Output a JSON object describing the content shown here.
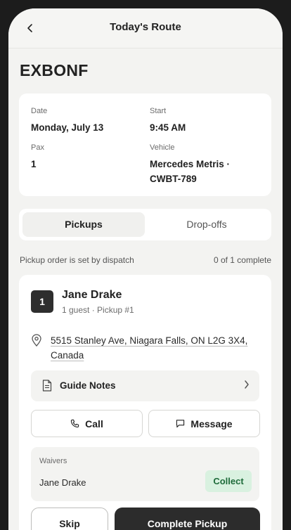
{
  "header": {
    "title": "Today's Route",
    "back_icon": "chevron-left-icon"
  },
  "route_code": "EXBONF",
  "details": {
    "date_label": "Date",
    "date_value": "Monday, July 13",
    "start_label": "Start",
    "start_value": "9:45 AM",
    "pax_label": "Pax",
    "pax_value": "1",
    "vehicle_label": "Vehicle",
    "vehicle_value": "Mercedes Metris · CWBT-789"
  },
  "tabs": {
    "pickups": "Pickups",
    "dropoffs": "Drop-offs",
    "active": "Pickups"
  },
  "progress": {
    "note": "Pickup order is set by dispatch",
    "status": "0 of 1 complete"
  },
  "stop": {
    "number": "1",
    "name": "Jane Drake",
    "subtitle": "1 guest · Pickup #1",
    "address": "5515 Stanley Ave, Niagara Falls, ON L2G 3X4, Canada",
    "guide_notes_label": "Guide Notes",
    "call_label": "Call",
    "message_label": "Message",
    "waivers_label": "Waivers",
    "waiver_name": "Jane Drake",
    "collect_label": "Collect",
    "skip_label": "Skip",
    "complete_label": "Complete Pickup"
  },
  "colors": {
    "background": "#f3f3f1",
    "card": "#ffffff",
    "dark_button": "#2c2c2c",
    "collect_bg": "#d9f1e0",
    "collect_text": "#1e6b3a"
  }
}
